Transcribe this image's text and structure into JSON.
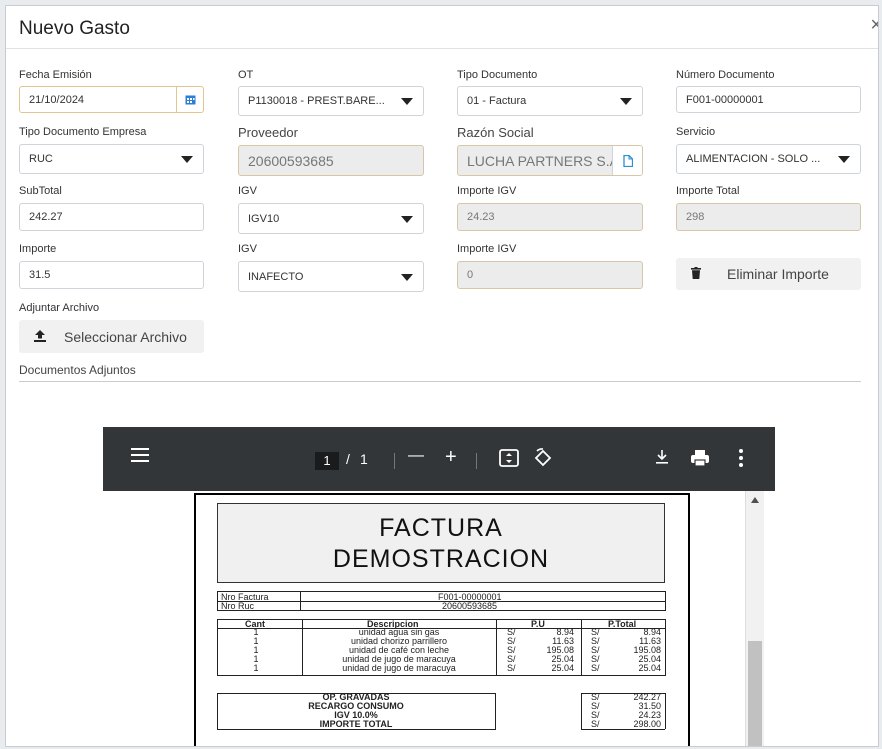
{
  "modal": {
    "title": "Nuevo Gasto",
    "close": "×"
  },
  "row1": {
    "fecha_label": "Fecha Emisión",
    "fecha_value": "21/10/2024",
    "ot_label": "OT",
    "ot_value": "P1130018 - PREST.BARE...",
    "tipo_doc_label": "Tipo Documento",
    "tipo_doc_value": "01 - Factura",
    "num_doc_label": "Número Documento",
    "num_doc_value": "F001-00000001"
  },
  "row2": {
    "tipo_doc_emp_label": "Tipo Documento Empresa",
    "tipo_doc_emp_value": "RUC",
    "proveedor_label": "Proveedor",
    "proveedor_value": "20600593685",
    "razon_label": "Razón Social",
    "razon_value": "LUCHA PARTNERS S.A.(",
    "servicio_label": "Servicio",
    "servicio_value": "ALIMENTACION - SOLO ..."
  },
  "row3": {
    "subtotal_label": "SubTotal",
    "subtotal_value": "242.27",
    "igv_label": "IGV",
    "igv_value": "IGV10",
    "importe_igv_label": "Importe IGV",
    "importe_igv_value": "24.23",
    "importe_total_label": "Importe Total",
    "importe_total_value": "298"
  },
  "row4": {
    "importe_label": "Importe",
    "importe_value": "31.5",
    "igv_label": "IGV",
    "igv_value": "INAFECTO",
    "importe_igv_label": "Importe IGV",
    "importe_igv_value": "0",
    "eliminar_label": "Eliminar Importe"
  },
  "adjuntar": {
    "label": "Adjuntar Archivo",
    "button": "Seleccionar Archivo"
  },
  "documentos": {
    "label": "Documentos Adjuntos"
  },
  "viewer": {
    "page_current": "1",
    "page_sep": "/",
    "page_total": "1",
    "minus": "—",
    "plus": "+"
  },
  "pdf": {
    "title_line1": "FACTURA",
    "title_line2": "DEMOSTRACION",
    "nro_factura_label": "Nro Factura",
    "nro_factura_value": "F001-00000001",
    "nro_ruc_label": "Nro Ruc",
    "nro_ruc_value": "20600593685",
    "headers": {
      "cant": "Cant",
      "desc": "Descripcion",
      "pu": "P.U",
      "ptotal": "P.Total"
    },
    "currency": "S/",
    "items": [
      {
        "cant": "1",
        "desc": "unidad agua sin gas",
        "pu": "8.94",
        "total": "8.94"
      },
      {
        "cant": "1",
        "desc": "unidad chorizo parrillero",
        "pu": "11.63",
        "total": "11.63"
      },
      {
        "cant": "1",
        "desc": "unidad de café con leche",
        "pu": "195.08",
        "total": "195.08"
      },
      {
        "cant": "1",
        "desc": "unidad de jugo de maracuya",
        "pu": "25.04",
        "total": "25.04"
      },
      {
        "cant": "1",
        "desc": "unidad de jugo de maracuya",
        "pu": "25.04",
        "total": "25.04"
      }
    ],
    "totals": [
      {
        "label": "OP. GRAVADAS",
        "value": "242.27"
      },
      {
        "label": "RECARGO CONSUMO",
        "value": "31.50"
      },
      {
        "label": "IGV 10.0%",
        "value": "24.23"
      },
      {
        "label": "IMPORTE TOTAL",
        "value": "298.00"
      }
    ]
  }
}
